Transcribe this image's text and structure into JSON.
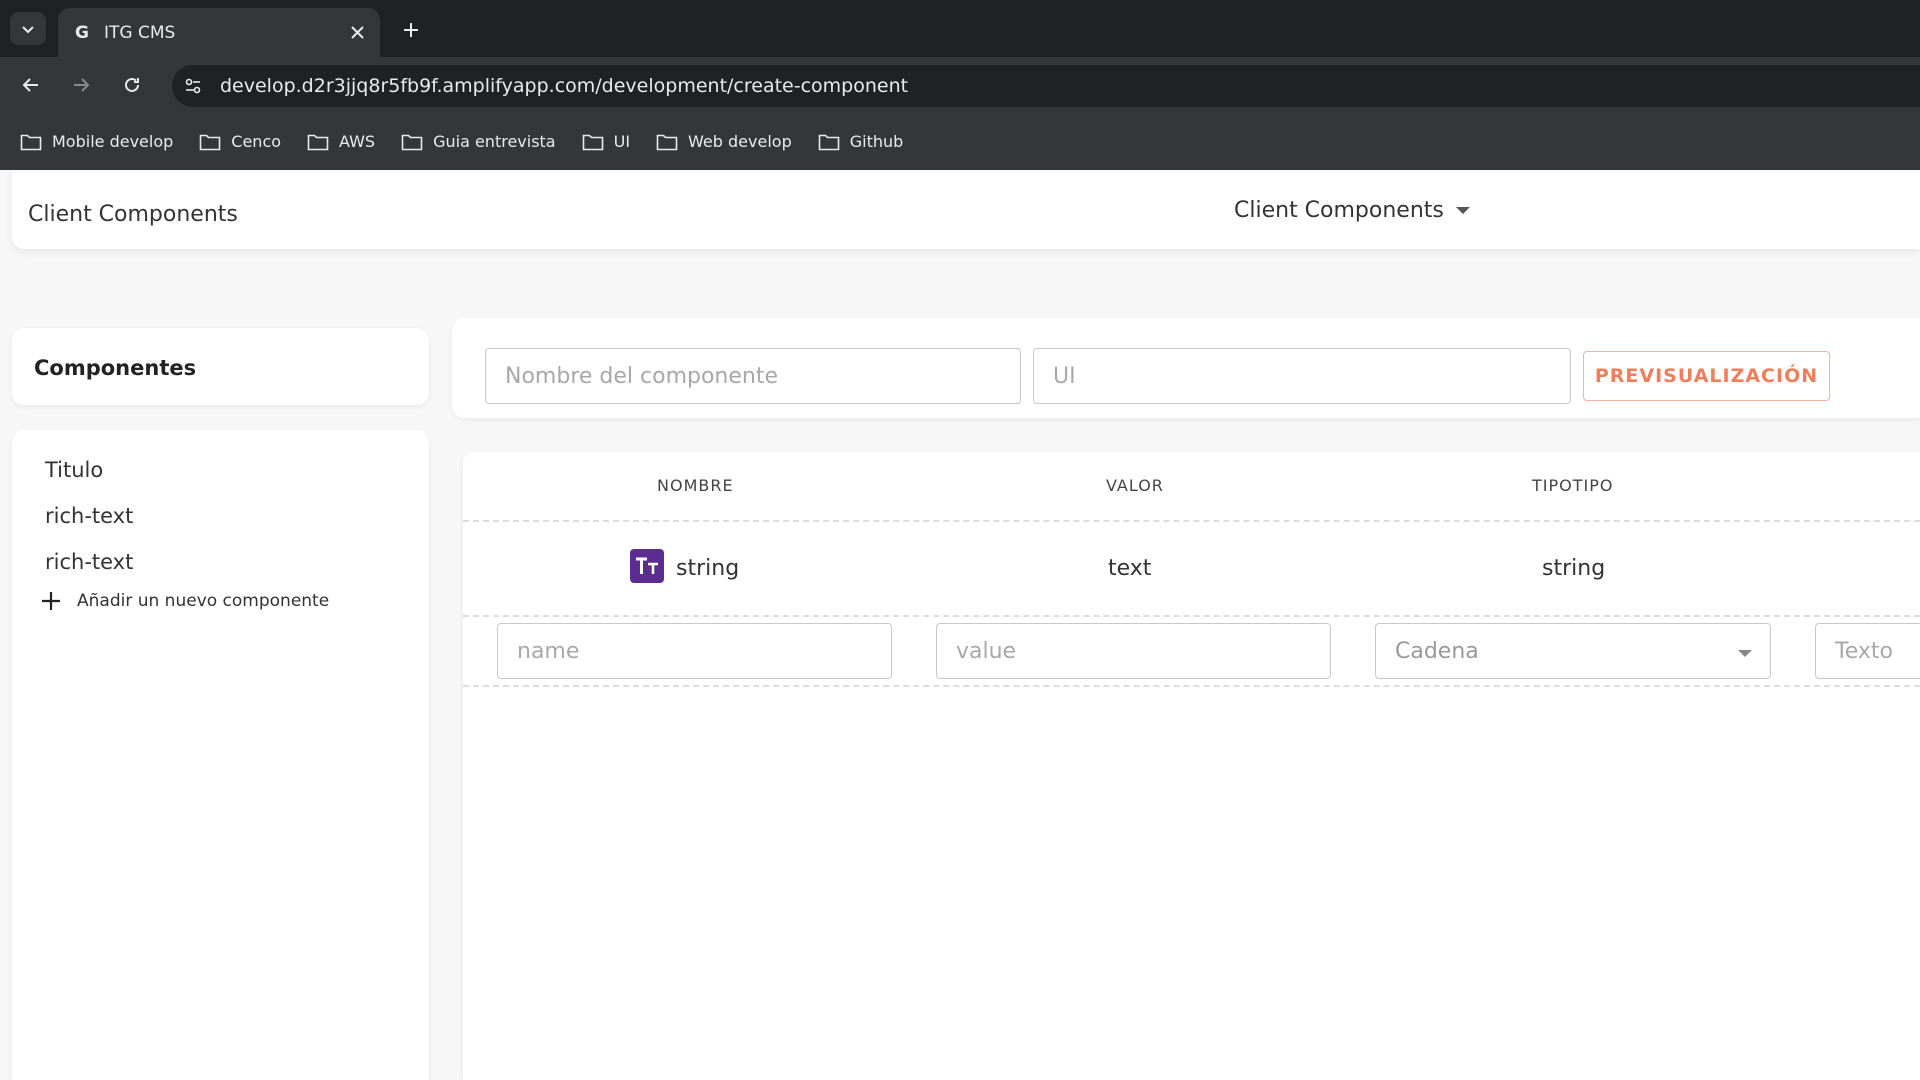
{
  "browser": {
    "tab_title": "ITG CMS",
    "favicon_letter": "G",
    "url": "develop.d2r3jjq8r5fb9f.amplifyapp.com/development/create-component",
    "bookmarks": [
      "Mobile develop",
      "Cenco",
      "AWS",
      "Guia entrevista",
      "UI",
      "Web develop",
      "Github"
    ]
  },
  "header": {
    "title": "Client Components",
    "dropdown_label": "Client Components"
  },
  "sidebar": {
    "title": "Componentes",
    "items": [
      "Titulo",
      "rich-text",
      "rich-text"
    ],
    "add_label": "Añadir un nuevo componente"
  },
  "form": {
    "name_placeholder": "Nombre del componente",
    "ui_placeholder": "UI",
    "preview_label": "PREVISUALIZACIÓN"
  },
  "table": {
    "headers": [
      "NOMBRE",
      "VALOR",
      "TIPOTIPO"
    ],
    "row": {
      "name": "string",
      "value": "text",
      "type": "string"
    },
    "new_row": {
      "name_placeholder": "name",
      "value_placeholder": "value",
      "type_selected": "Cadena",
      "extra_placeholder": "Texto"
    }
  }
}
